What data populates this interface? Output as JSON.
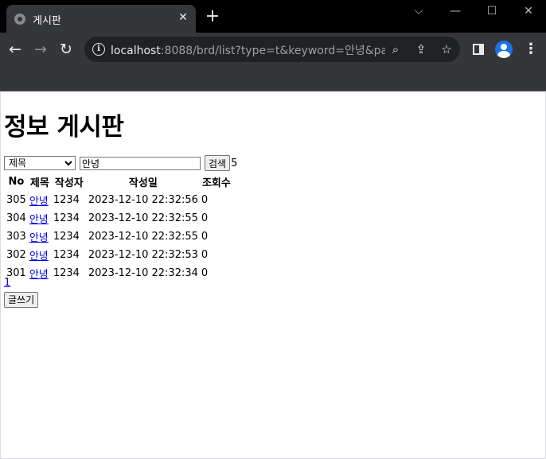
{
  "browser": {
    "tab_title": "게시판",
    "tab_close": "✕",
    "new_tab": "+",
    "window_controls": {
      "chevron": "⌵",
      "minimize": "—",
      "maximize": "☐",
      "close": "✕"
    },
    "nav": {
      "back": "←",
      "forward": "→",
      "reload": "↻"
    },
    "url_host": "localhost",
    "url_rest": ":8088/brd/list?type=t&keyword=안녕&pag...",
    "icons": [
      "zoom-icon",
      "share-icon",
      "bookmark-star-icon",
      "side-panel-icon",
      "profile-avatar",
      "menu-icon"
    ]
  },
  "page": {
    "title": "정보 게시판",
    "search": {
      "type_selected": "제목",
      "keyword_value": "안녕",
      "button_label": "검색",
      "result_count": "5"
    },
    "table": {
      "headers": [
        "No",
        "제목",
        "작성자",
        "작성일",
        "조회수"
      ],
      "rows": [
        {
          "no": "305",
          "title": "안녕",
          "writer": "1234",
          "date": "2023-12-10 22:32:56",
          "views": "0"
        },
        {
          "no": "304",
          "title": "안녕",
          "writer": "1234",
          "date": "2023-12-10 22:32:55",
          "views": "0"
        },
        {
          "no": "303",
          "title": "안녕",
          "writer": "1234",
          "date": "2023-12-10 22:32:55",
          "views": "0"
        },
        {
          "no": "302",
          "title": "안녕",
          "writer": "1234",
          "date": "2023-12-10 22:32:53",
          "views": "0"
        },
        {
          "no": "301",
          "title": "안녕",
          "writer": "1234",
          "date": "2023-12-10 22:32:34",
          "views": "0"
        }
      ]
    },
    "pagination": {
      "page_1": "1"
    },
    "write_button": "글쓰기"
  },
  "colors": {
    "tab_bar": "#000000",
    "toolbar": "#35363a",
    "omnibox": "#202124",
    "link": "#0000ee",
    "avatar": "#1a73e8"
  }
}
